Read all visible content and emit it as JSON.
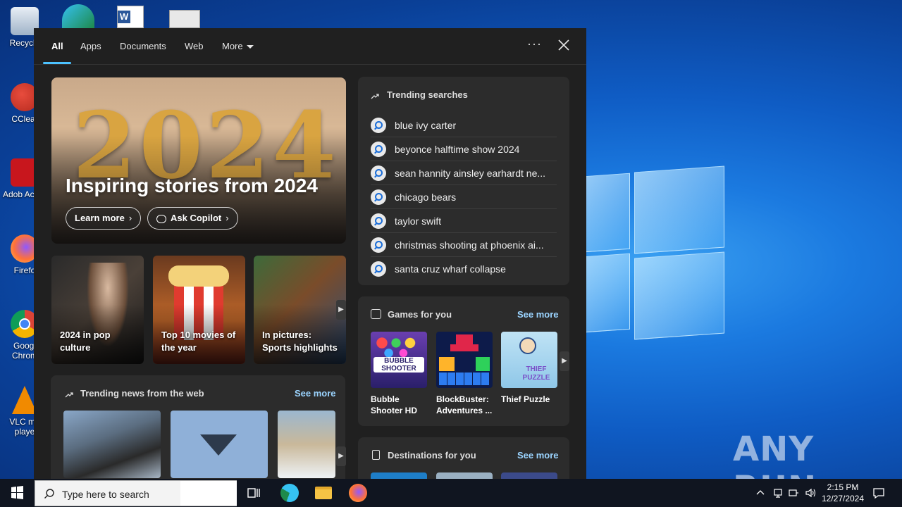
{
  "desktop": {
    "icons": [
      {
        "name": "recycle-bin",
        "label": "Recycle"
      },
      {
        "name": "ccleaner",
        "label": "CClear"
      },
      {
        "name": "adobe-acrobat",
        "label": "Adob Acrob"
      },
      {
        "name": "firefox",
        "label": "Firefo"
      },
      {
        "name": "google-chrome",
        "label": "Googl Chrom"
      },
      {
        "name": "vlc",
        "label": "VLC me playe"
      }
    ],
    "watermark": "ANY RUN"
  },
  "search_panel": {
    "tabs": [
      {
        "label": "All",
        "active": true
      },
      {
        "label": "Apps"
      },
      {
        "label": "Documents"
      },
      {
        "label": "Web"
      },
      {
        "label": "More"
      }
    ],
    "more_options": "···",
    "hero": {
      "image_text": "2024",
      "title": "Inspiring stories from 2024",
      "learn_more": "Learn more",
      "ask_copilot": "Ask Copilot"
    },
    "tiles": [
      {
        "label": "2024 in pop culture"
      },
      {
        "label": "Top 10 movies of the year"
      },
      {
        "label": "In pictures: Sports highlights"
      }
    ],
    "trending_searches": {
      "title": "Trending searches",
      "items": [
        "blue ivy carter",
        "beyonce halftime show 2024",
        "sean hannity ainsley earhardt ne...",
        "chicago bears",
        "taylor swift",
        "christmas shooting at phoenix ai...",
        "santa cruz wharf collapse"
      ]
    },
    "games": {
      "title": "Games for you",
      "see_more": "See more",
      "items": [
        {
          "label": "Bubble Shooter HD",
          "thumb_text": "BUBBLE SHOOTER"
        },
        {
          "label": "BlockBuster: Adventures ..."
        },
        {
          "label": "Thief Puzzle",
          "thumb_text": "THIEF PUZZLE"
        }
      ]
    },
    "trending_news": {
      "title": "Trending news from the web",
      "see_more": "See more"
    },
    "destinations": {
      "title": "Destinations for you",
      "see_more": "See more"
    }
  },
  "taskbar": {
    "search_placeholder": "Type here to search",
    "time": "2:15 PM",
    "date": "12/27/2024"
  }
}
